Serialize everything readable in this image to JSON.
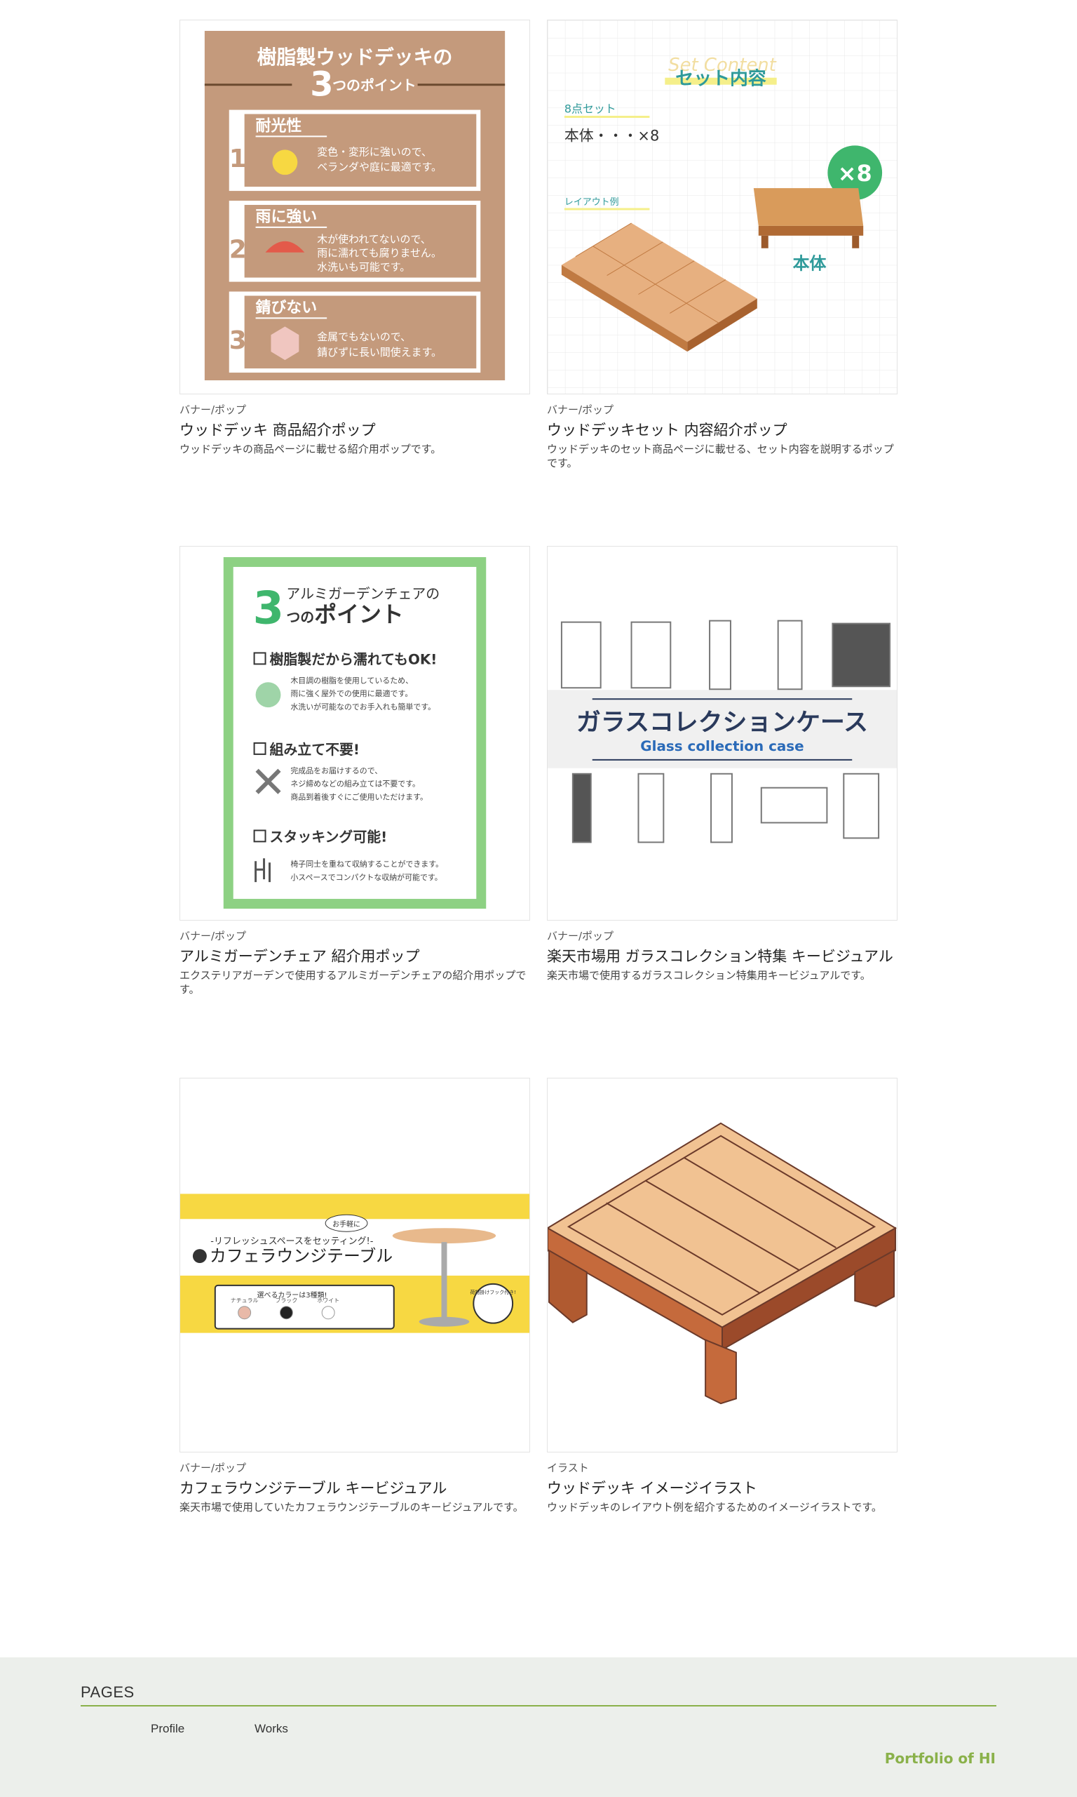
{
  "works": [
    {
      "category": "バナー/ポップ",
      "title": "ウッドデッキ 商品紹介ポップ",
      "description": "ウッドデッキの商品ページに載せる紹介用ポップです。",
      "image": {
        "heading_top": "樹脂製ウッドデッキの",
        "heading_num": "3",
        "heading_bottom": "つのポイント",
        "points": [
          {
            "num": "1",
            "title": "耐光性",
            "line1": "変色・変形に強いので、",
            "line2": "ベランダや庭に最適です。",
            "line3": ""
          },
          {
            "num": "2",
            "title": "雨に強い",
            "line1": "木が使われてないので、",
            "line2": "雨に濡れても腐りません。",
            "line3": "水洗いも可能です。"
          },
          {
            "num": "3",
            "title": "錆びない",
            "line1": "金属でもないので、",
            "line2": "錆びずに長い間使えます。",
            "line3": ""
          }
        ]
      }
    },
    {
      "category": "バナー/ポップ",
      "title": "ウッドデッキセット 内容紹介ポップ",
      "description": "ウッドデッキのセット商品ページに載せる、セット内容を説明するポップです。",
      "image": {
        "script": "Set Content",
        "heading": "セット内容",
        "set_label": "8点セット",
        "set_item": "本体・・・×8",
        "layout_label": "レイアウト例",
        "badge": "×8",
        "body_label": "本体"
      }
    },
    {
      "category": "バナー/ポップ",
      "title": "アルミガーデンチェア 紹介用ポップ",
      "description": "エクステリアガーデンで使用するアルミガーデンチェアの紹介用ポップです。",
      "image": {
        "num": "3",
        "heading_top": "アルミガーデンチェアの",
        "heading_bottom_a": "つの",
        "heading_bottom_b": "ポイント",
        "points": [
          {
            "title": "樹脂製だから濡れてもOK!",
            "line1": "木目調の樹脂を使用しているため、",
            "line2": "雨に強く屋外での使用に最適です。",
            "line3": "水洗いが可能なのでお手入れも簡単です。"
          },
          {
            "title": "組み立て不要!",
            "line1": "完成品をお届けするので、",
            "line2": "ネジ締めなどの組み立ては不要です。",
            "line3": "商品到着後すぐにご使用いただけます。"
          },
          {
            "title": "スタッキング可能!",
            "line1": "椅子同士を重ねて収納することができます。",
            "line2": "小スペースでコンパクトな収納が可能です。",
            "line3": ""
          }
        ]
      }
    },
    {
      "category": "バナー/ポップ",
      "title": "楽天市場用 ガラスコレクション特集 キービジュアル",
      "description": "楽天市場で使用するガラスコレクション特集用キービジュアルです。",
      "image": {
        "title_jp": "ガラスコレクションケース",
        "title_en": "Glass collection case"
      }
    },
    {
      "category": "バナー/ポップ",
      "title": "カフェラウンジテーブル キービジュアル",
      "description": "楽天市場で使用していたカフェラウンジテーブルのキービジュアルです。",
      "image": {
        "tagline": "-リフレッシュスペースをセッティング!-",
        "bubble": "お手軽に",
        "product": "カフェラウンジテーブル",
        "color_title": "選べるカラーは3種類!",
        "colors": [
          {
            "name": "ナチュラル",
            "hex": "#e8b9a8"
          },
          {
            "name": "ブラック",
            "hex": "#222222"
          },
          {
            "name": "ホワイト",
            "hex": "#ffffff"
          }
        ],
        "hook_badge": "荷物掛けフック付き!"
      }
    },
    {
      "category": "イラスト",
      "title": "ウッドデッキ イメージイラスト",
      "description": "ウッドデッキのレイアウト例を紹介するためのイメージイラストです。",
      "image": {}
    }
  ],
  "footer": {
    "pages_heading": "PAGES",
    "links": [
      "Profile",
      "Works"
    ],
    "brand": "Portfolio of HI"
  },
  "colors": {
    "accent_green": "#8ab14a",
    "wood_tan": "#c49a7c",
    "pop_green": "#3fb66d",
    "cafe_yellow": "#f7d842",
    "glass_navy": "#2a3a5c"
  }
}
